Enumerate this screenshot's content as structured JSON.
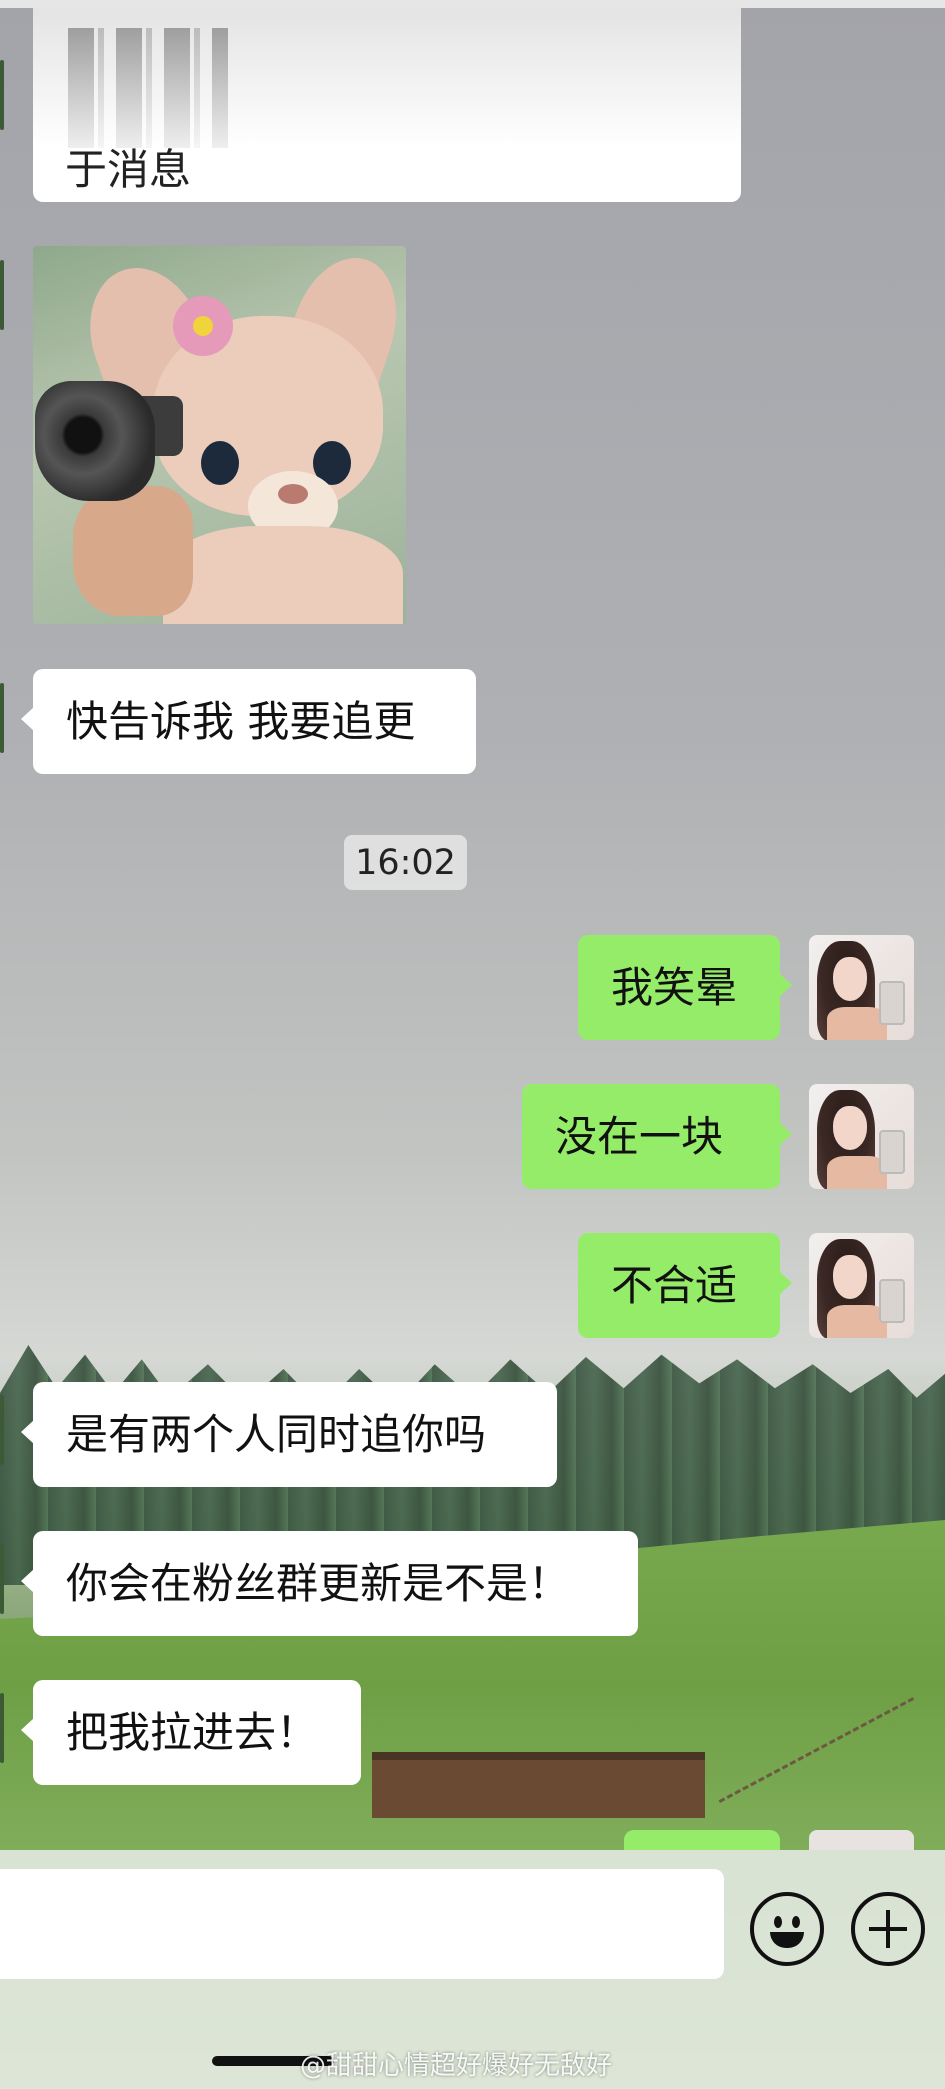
{
  "chat": {
    "top_partial_message": "于消息",
    "messages": [
      {
        "side": "left",
        "text": "快告诉我 我要追更"
      },
      {
        "side": "right",
        "text": "我笑晕"
      },
      {
        "side": "right",
        "text": "没在一块"
      },
      {
        "side": "right",
        "text": "不合适"
      },
      {
        "side": "left",
        "text": "是有两个人同时追你吗"
      },
      {
        "side": "left",
        "text": "你会在粉丝群更新是不是！"
      },
      {
        "side": "left",
        "text": "把我拉进去！"
      }
    ],
    "timestamp": "16:02"
  },
  "input": {
    "placeholder": ""
  },
  "watermark": "@甜甜心情超好爆好无敌好",
  "colors": {
    "own_bubble": "#95ec69",
    "other_bubble": "#ffffff"
  },
  "icons": [
    "emoji-icon",
    "plus-icon"
  ]
}
